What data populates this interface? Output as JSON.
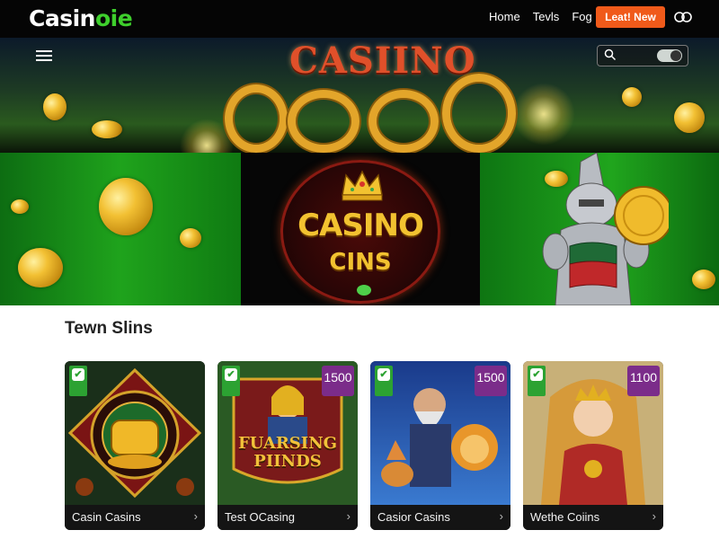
{
  "brand": {
    "name_main": "Casin",
    "name_accent": "oie"
  },
  "nav": {
    "items": [
      "Home",
      "Tevls",
      "Fog"
    ]
  },
  "cta": {
    "label": "Leat! New"
  },
  "user": {
    "glyph": "⊙‹"
  },
  "hero": {
    "banner_text": "CASIINO",
    "emblem_title": "CASINO",
    "emblem_sub": "CINS"
  },
  "section": {
    "title": "Tewn Slins"
  },
  "cards": [
    {
      "name": "Casin Casins",
      "overlay": "",
      "badge_left": "",
      "badge_right_value": "",
      "badge_right_label": ""
    },
    {
      "name": "Test OCasing",
      "overlay": "FUARSING PIINDS",
      "badge_left": "",
      "badge_right_value": "1500",
      "badge_right_label": ""
    },
    {
      "name": "Casior Casins",
      "overlay": "",
      "badge_left": "",
      "badge_right_value": "1500",
      "badge_right_label": ""
    },
    {
      "name": "Wethe Coiins",
      "overlay": "",
      "badge_left": "",
      "badge_right_value": "1100",
      "badge_right_label": ""
    }
  ],
  "colors": {
    "brand_accent": "#3ecf2c",
    "cta": "#f05a1a",
    "badge_green": "#2ca232",
    "badge_purple": "#7b2c8a"
  }
}
